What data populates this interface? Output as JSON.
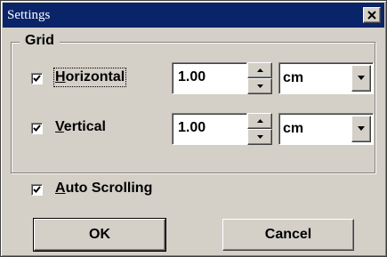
{
  "window": {
    "title": "Settings",
    "close_icon": "close-icon",
    "colors": {
      "titlebar": "#0a246a",
      "face": "#d4d0c8"
    }
  },
  "grid": {
    "label": "Grid",
    "horizontal": {
      "label_ul": "H",
      "label_rest": "orizontal",
      "checked": true,
      "value": "1.00",
      "unit": "cm"
    },
    "vertical": {
      "label_ul": "V",
      "label_rest": "ertical",
      "checked": true,
      "value": "1.00",
      "unit": "cm"
    }
  },
  "auto_scrolling": {
    "label_ul": "A",
    "label_rest": "uto Scrolling",
    "checked": true
  },
  "buttons": {
    "ok": "OK",
    "cancel": "Cancel"
  }
}
